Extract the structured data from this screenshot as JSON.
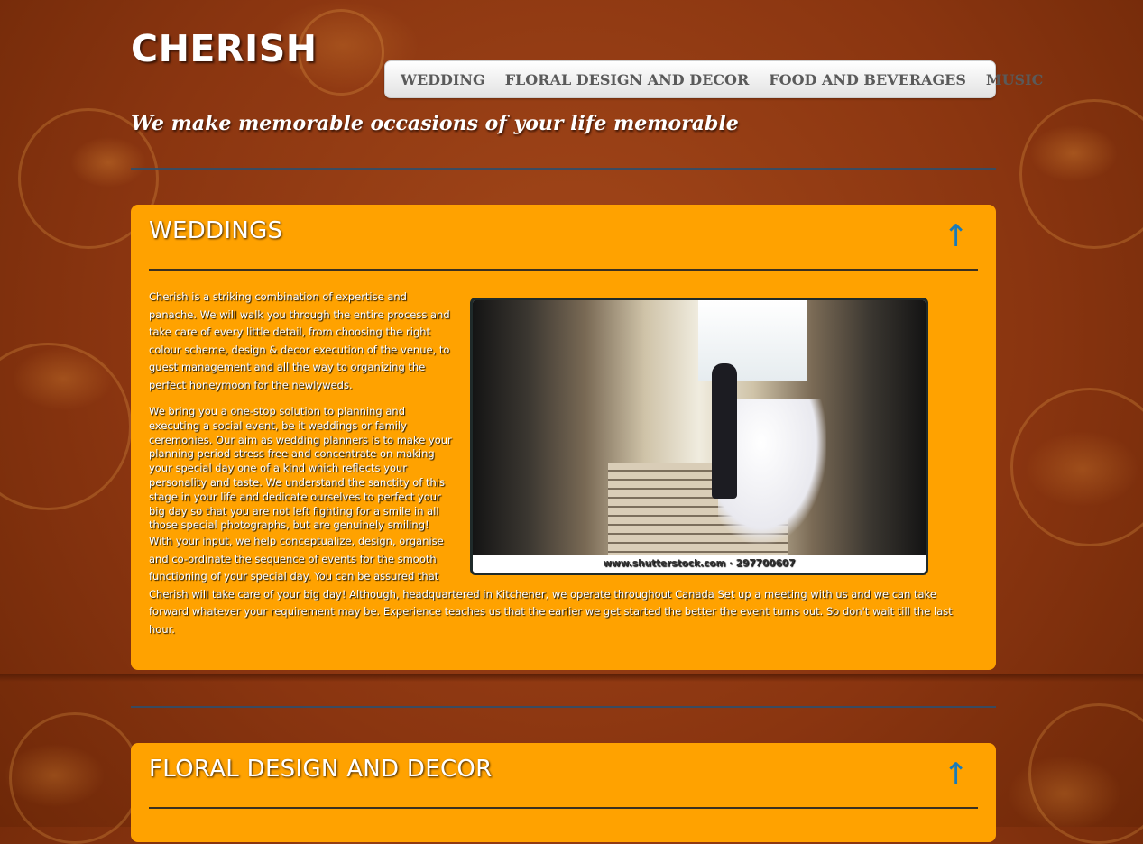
{
  "header": {
    "logo": "CHERISH",
    "tagline": "We make memorable occasions of your life memorable"
  },
  "nav": {
    "items": [
      {
        "label": "WEDDING"
      },
      {
        "label": "FLORAL DESIGN AND DECOR"
      },
      {
        "label": "FOOD AND BEVERAGES"
      },
      {
        "label": "MUSIC"
      }
    ]
  },
  "sections": [
    {
      "title": "WEDDINGS",
      "up_arrow": "↑",
      "paragraphs": [
        "Cherish is a striking combination of expertise and panache. We will walk you through the entire process and take care of every little detail, from choosing the right colour scheme, design & decor execution of the venue, to guest management and all the way to organizing the perfect honeymoon for the newlyweds.",
        "We bring you a one-stop solution to planning and executing a social event, be it weddings or family ceremonies. Our aim as wedding planners is to make your planning period stress free and concentrate on making your special day one of a kind which reflects your personality and taste. We understand the sanctity of this stage in your life and dedicate ourselves to perfect your big day so that you are not left fighting for a smile in all those special photographs, but are genuinely smiling!",
        "With your input, we help conceptualize, design, organise and co-ordinate the sequence of events for the smooth functioning of your special day. You can be assured that Cherish will take care of your big day! Although, headquartered in Kitchener, we operate throughout Canada Set up a meeting with us and we can take forward whatever your requirement may be. Experience teaches us that the earlier we get started the better the event turns out. So don't wait till the last hour."
      ],
      "image_caption": "www.shutterstock.com · 297700607"
    },
    {
      "title": "FLORAL DESIGN AND DECOR",
      "up_arrow": "↑"
    }
  ],
  "colors": {
    "panel": "#ffa200",
    "arrow": "#1a7bb8",
    "background": "#8e3a12"
  }
}
